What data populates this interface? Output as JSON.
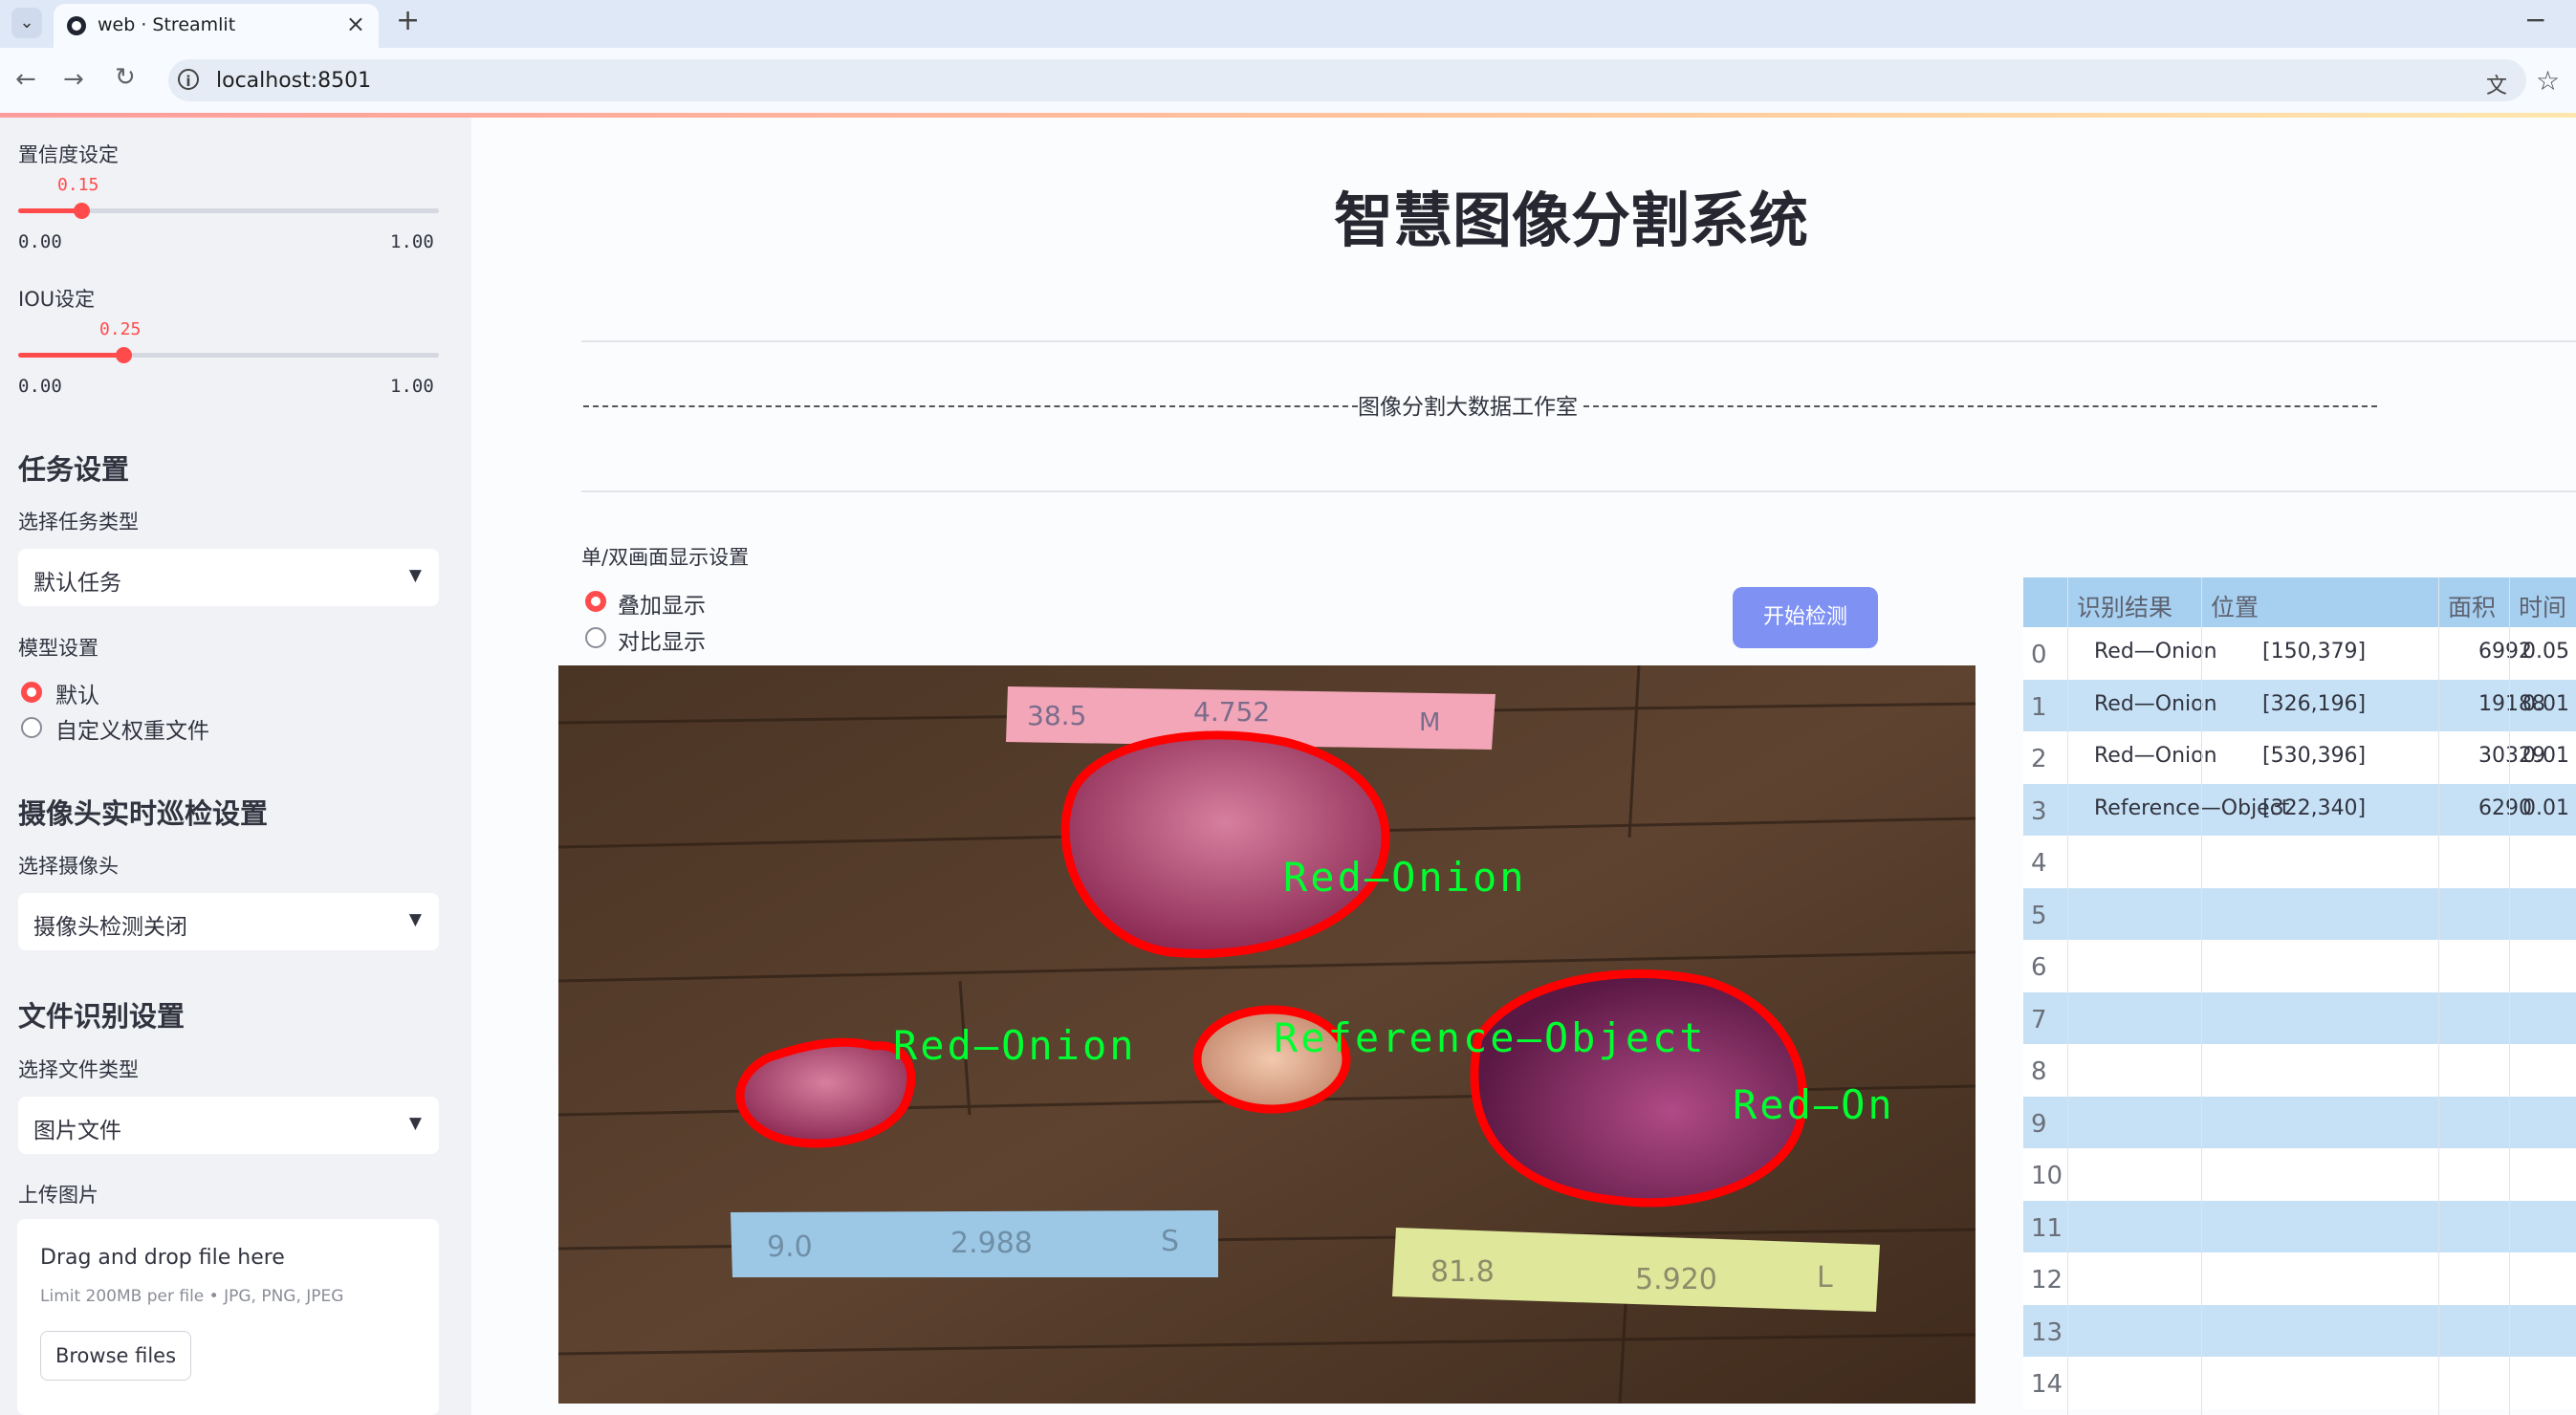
{
  "browser": {
    "tab_title": "web · Streamlit",
    "url": "localhost:8501",
    "new_tab": "+",
    "close": "×",
    "minimize": "−"
  },
  "sidebar": {
    "confidence": {
      "label": "置信度设定",
      "value": "0.15",
      "min": "0.00",
      "max": "1.00",
      "fraction": 0.15
    },
    "iou": {
      "label": "IOU设定",
      "value": "0.25",
      "min": "0.00",
      "max": "1.00",
      "fraction": 0.25
    },
    "task_header": "任务设置",
    "task_type_label": "选择任务类型",
    "task_type_value": "默认任务",
    "model_label": "模型设置",
    "model_options": [
      "默认",
      "自定义权重文件"
    ],
    "model_selected": "默认",
    "camera_header": "摄像头实时巡检设置",
    "camera_label": "选择摄像头",
    "camera_value": "摄像头检测关闭",
    "file_header": "文件识别设置",
    "file_type_label": "选择文件类型",
    "file_type_value": "图片文件",
    "upload_label": "上传图片",
    "drop_title": "Drag and drop file here",
    "drop_limit": "Limit 200MB per file • JPG, PNG, JPEG",
    "browse_button": "Browse files"
  },
  "main": {
    "title": "智慧图像分割系统",
    "subtitle": "图像分割大数据工作室",
    "display_label": "单/双画面显示设置",
    "display_options": [
      "叠加显示",
      "对比显示"
    ],
    "display_selected": "叠加显示",
    "start_button": "开始检测"
  },
  "image": {
    "labels": [
      "Red—Onion",
      "Reference—Object",
      "Red—Onion",
      "Red—On"
    ],
    "paper_texts": [
      "38.5",
      "4.752",
      "M",
      "9.0",
      "2.988",
      "S",
      "81.8",
      "5.920",
      "L"
    ]
  },
  "table": {
    "headers": [
      "识别结果",
      "位置",
      "面积",
      "时间"
    ],
    "rows": [
      {
        "index": "0",
        "result": "Red—Onion",
        "position": "[150,379]",
        "area": "6992",
        "time": "0.05"
      },
      {
        "index": "1",
        "result": "Red—Onion",
        "position": "[326,196]",
        "area": "19188",
        "time": "0.01"
      },
      {
        "index": "2",
        "result": "Red—Onion",
        "position": "[530,396]",
        "area": "30329",
        "time": "0.01"
      },
      {
        "index": "3",
        "result": "Reference—Object",
        "position": "[322,340]",
        "area": "6290",
        "time": "0.01"
      }
    ],
    "empty_indices": [
      "4",
      "5",
      "6",
      "7",
      "8",
      "9",
      "10",
      "11",
      "12",
      "13",
      "14"
    ]
  },
  "colors": {
    "accent": "#ff4b4b",
    "button": "#7f92f4",
    "table_row": "#c6e1f6",
    "mask_outline": "#ff0000",
    "label_text": "#00ff30"
  }
}
